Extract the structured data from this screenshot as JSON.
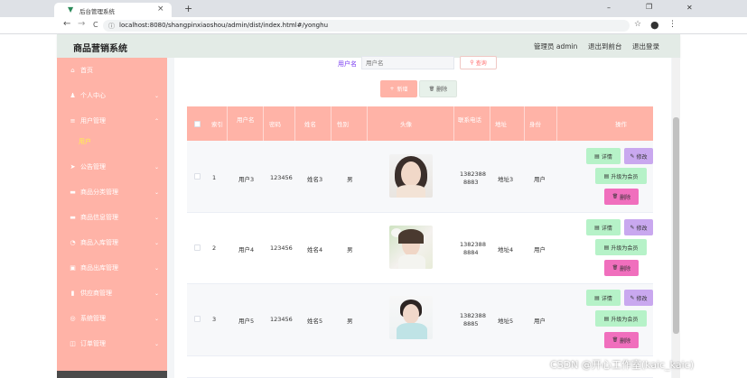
{
  "browser": {
    "tab_title": "后台管理系统",
    "url": "localhost:8080/shangpinxiaoshou/admin/dist/index.html#/yonghu",
    "new_tab": "+",
    "close_tab": "×",
    "win_min": "–",
    "win_max": "❐",
    "win_close": "✕",
    "back": "←",
    "forward": "→",
    "reload": "C"
  },
  "header": {
    "app_title": "商品营销系统",
    "user_label": "管理员 admin",
    "front_link": "退出到前台",
    "logout_link": "退出登录"
  },
  "sidebar": {
    "items": [
      {
        "label": "首页",
        "icon": "⌂",
        "arrow": ""
      },
      {
        "label": "个人中心",
        "icon": "♟",
        "arrow": "⌄"
      },
      {
        "label": "用户管理",
        "icon": "≡",
        "arrow": "⌃"
      },
      {
        "label": "用户",
        "icon": "",
        "arrow": ""
      },
      {
        "label": "公告管理",
        "icon": "➤",
        "arrow": "⌄"
      },
      {
        "label": "商品分类管理",
        "icon": "▬",
        "arrow": "⌄"
      },
      {
        "label": "商品信息管理",
        "icon": "▬",
        "arrow": "⌄"
      },
      {
        "label": "商品入库管理",
        "icon": "◔",
        "arrow": "⌄"
      },
      {
        "label": "商品出库管理",
        "icon": "▣",
        "arrow": "⌄"
      },
      {
        "label": "供应商管理",
        "icon": "▮",
        "arrow": "⌄"
      },
      {
        "label": "系统管理",
        "icon": "◎",
        "arrow": "⌄"
      },
      {
        "label": "订单管理",
        "icon": "◫",
        "arrow": "⌄"
      }
    ]
  },
  "search": {
    "label": "用户名",
    "placeholder": "用户名",
    "button": "查询",
    "button_icon": "⚲"
  },
  "actions": {
    "add": "新增",
    "add_icon": "+",
    "delete": "删除",
    "delete_icon": "🗑"
  },
  "table": {
    "columns": [
      "索引",
      "用户名",
      "密码",
      "姓名",
      "性别",
      "头像",
      "联系电话",
      "地址",
      "身份",
      "操作"
    ],
    "rows": [
      {
        "index": "1",
        "username": "用户3",
        "password": "123456",
        "name": "姓名3",
        "gender": "男",
        "phone1": "1382388",
        "phone2": "8883",
        "address": "地址3",
        "role": "用户"
      },
      {
        "index": "2",
        "username": "用户4",
        "password": "123456",
        "name": "姓名4",
        "gender": "男",
        "phone1": "1382388",
        "phone2": "8884",
        "address": "地址4",
        "role": "用户"
      },
      {
        "index": "3",
        "username": "用户5",
        "password": "123456",
        "name": "姓名5",
        "gender": "男",
        "phone1": "1382388",
        "phone2": "8885",
        "address": "地址5",
        "role": "用户"
      }
    ],
    "row_buttons": {
      "detail": "详情",
      "edit": "修改",
      "upgrade": "升级为会员",
      "delete": "删除",
      "detail_icon": "▤",
      "edit_icon": "✎",
      "upgrade_icon": "▤",
      "delete_icon": "🗑"
    }
  },
  "watermark": "CSDN @开心工作室(kaic_kaic)",
  "colors": {
    "sidebar": "#ffb3a7",
    "header": "#e3ebe6",
    "table_head": "#ffb3a7",
    "add_btn": "#ffb3a7",
    "detail_btn": "#b6f2c8",
    "edit_btn": "#c9a8ef",
    "upgrade_btn": "#b6f2c8",
    "delete_btn": "#f06fbd",
    "accent": "#7a3cf0"
  }
}
